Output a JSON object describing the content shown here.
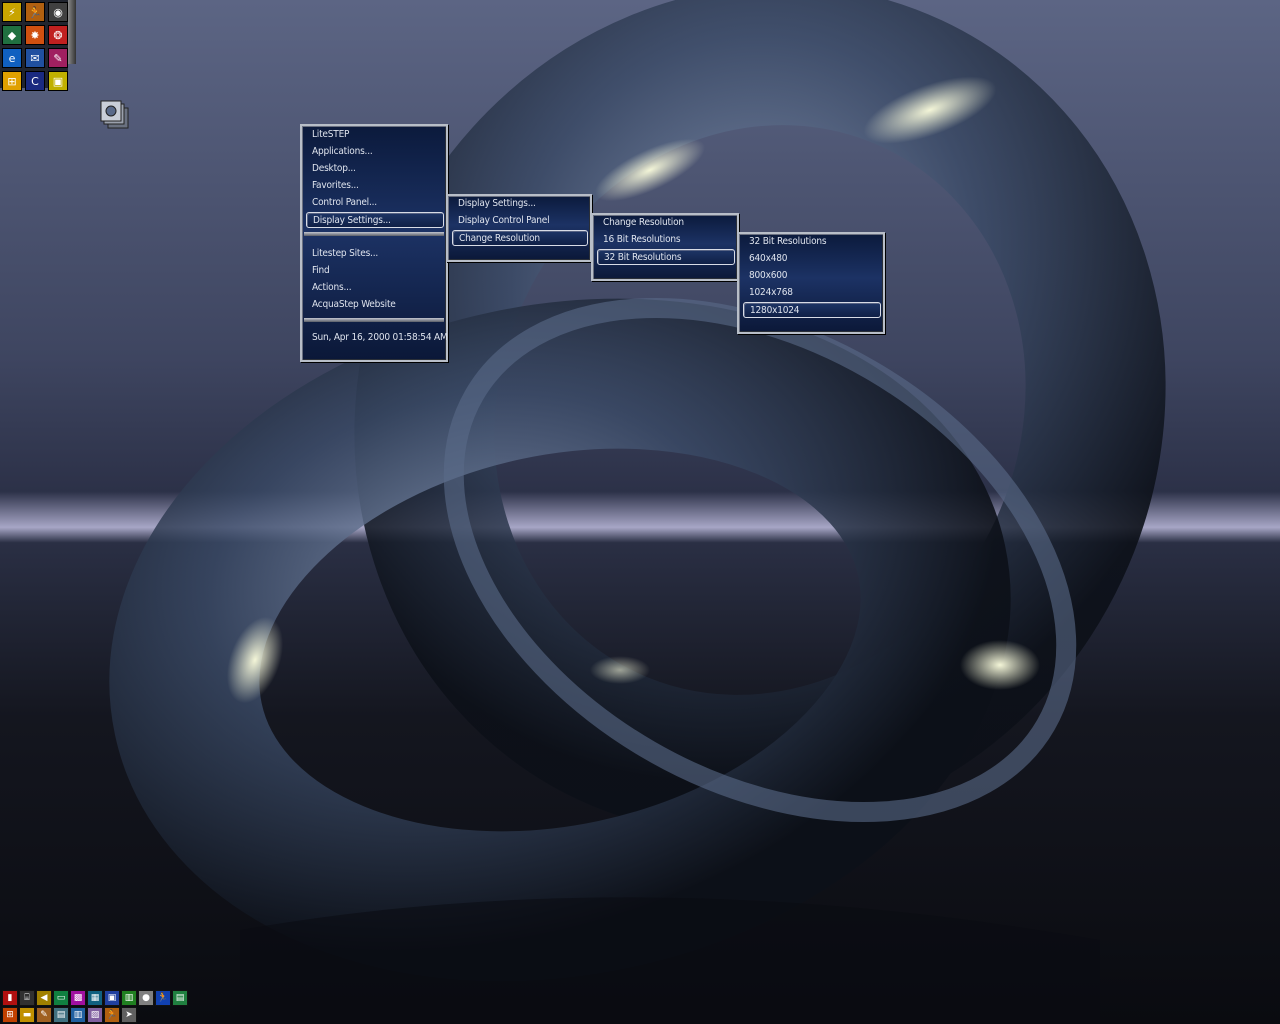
{
  "colors": {
    "menu_bg": "#1c3264",
    "menu_border": "#b8bec8",
    "menu_text": "#dfe4ee",
    "horizon": "#a7a6c6"
  },
  "shortcuts": [
    {
      "icon": "winamp-icon",
      "glyph": "⚡",
      "color": "#c8a400"
    },
    {
      "icon": "runner-icon",
      "glyph": "🏃",
      "color": "#b06010"
    },
    {
      "icon": "monitor-eye-icon",
      "glyph": "◉",
      "color": "#404040"
    },
    {
      "icon": "shield-icon",
      "glyph": "◆",
      "color": "#207040"
    },
    {
      "icon": "sparkle-icon",
      "glyph": "✸",
      "color": "#d05010"
    },
    {
      "icon": "color-wheel-icon",
      "glyph": "❂",
      "color": "#c02020"
    },
    {
      "icon": "internet-explorer-icon",
      "glyph": "e",
      "color": "#1060c0"
    },
    {
      "icon": "network-icon",
      "glyph": "✉",
      "color": "#2050a0"
    },
    {
      "icon": "paint-icon",
      "glyph": "✎",
      "color": "#a02060"
    },
    {
      "icon": "windows-icon",
      "glyph": "⊞",
      "color": "#e0a000"
    },
    {
      "icon": "cpp-icon",
      "glyph": "C",
      "color": "#1a2a80"
    },
    {
      "icon": "control-panel-icon",
      "glyph": "▣",
      "color": "#c0b000"
    }
  ],
  "menus": {
    "main": {
      "items_top": [
        "LiteSTEP",
        "Applications...",
        "Desktop...",
        "Favorites...",
        "Control Panel...",
        "Display Settings..."
      ],
      "items_mid": [
        "Litestep Sites...",
        "Find",
        "Actions...",
        "AcquaStep Website"
      ],
      "clock": "Sun, Apr 16, 2000 01:58:54 AM"
    },
    "display": {
      "items": [
        "Display Settings...",
        "Display Control Panel",
        "Change Resolution"
      ]
    },
    "resolution": {
      "items": [
        "Change Resolution",
        "16 Bit Resolutions",
        "32 Bit Resolutions"
      ]
    },
    "bit32": {
      "items": [
        "32 Bit Resolutions",
        "640x480",
        "800x600",
        "1024x768",
        "1280x1024"
      ]
    }
  },
  "tray_top": [
    {
      "icon": "app-red-icon",
      "glyph": "▮",
      "color": "#b01010"
    },
    {
      "icon": "network-drive-icon",
      "glyph": "⌸",
      "color": "#303030"
    },
    {
      "icon": "speaker-icon",
      "glyph": "◀",
      "color": "#a08000"
    },
    {
      "icon": "monitor-icon",
      "glyph": "▭",
      "color": "#108040"
    },
    {
      "icon": "palette-icon",
      "glyph": "▩",
      "color": "#a010a0"
    },
    {
      "icon": "grid-app-icon",
      "glyph": "▦",
      "color": "#106080"
    },
    {
      "icon": "display-icon",
      "glyph": "▣",
      "color": "#2040a0"
    },
    {
      "icon": "chart-icon",
      "glyph": "▥",
      "color": "#208020"
    },
    {
      "icon": "mouse-icon",
      "glyph": "●",
      "color": "#808080"
    },
    {
      "icon": "runner-icon",
      "glyph": "🏃",
      "color": "#1040b0"
    },
    {
      "icon": "screen-icon",
      "glyph": "▤",
      "color": "#208040"
    }
  ],
  "tray_bottom": [
    {
      "icon": "windows-start-icon",
      "glyph": "⊞",
      "color": "#c04000"
    },
    {
      "icon": "folder-icon",
      "glyph": "▬",
      "color": "#c09000"
    },
    {
      "icon": "pencil-icon",
      "glyph": "✎",
      "color": "#a06020"
    },
    {
      "icon": "printer-icon",
      "glyph": "▤",
      "color": "#407080"
    },
    {
      "icon": "notebook-icon",
      "glyph": "▥",
      "color": "#2060a0"
    },
    {
      "icon": "image-icon",
      "glyph": "▨",
      "color": "#8060a0"
    },
    {
      "icon": "runner-small-icon",
      "glyph": "🏃",
      "color": "#b06010"
    },
    {
      "icon": "pointer-icon",
      "glyph": "➤",
      "color": "#606060"
    }
  ]
}
